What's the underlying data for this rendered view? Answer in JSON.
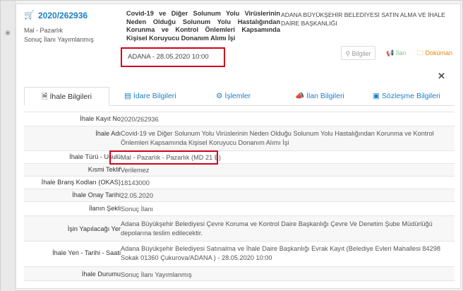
{
  "ihale": {
    "no": "2020/262936",
    "type": "Mal - Pazarlık",
    "status": "Sonuç İlanı Yayımlanmış",
    "title": "Covid-19 ve Diğer Solunum Yolu Virüslerinin Neden Olduğu Solunum Yolu Hastalığından Korunma ve Kontrol Önlemleri Kapsamında Kişisel Koruyucu Donanım Alımı İşi",
    "place_date": "ADANA - 28.05.2020 10:00",
    "org": "ADANA BÜYÜKŞEHİR BELEDİYESİ SATIN ALMA VE İHALE DAİRE BAŞKANLIĞI"
  },
  "buttons": {
    "bilgiler": "Bilgiler",
    "ilan": "İlan",
    "dokuman": "Doküman"
  },
  "tabs": [
    {
      "label": "İhale Bilgileri",
      "icon": "file-icon"
    },
    {
      "label": "İdare Bilgileri",
      "icon": "document-icon"
    },
    {
      "label": "İşlemler",
      "icon": "gears-icon"
    },
    {
      "label": "İlan Bilgileri",
      "icon": "bullhorn-icon"
    },
    {
      "label": "Sözleşme Bilgileri",
      "icon": "contract-icon"
    }
  ],
  "rows": [
    {
      "label": "İhale Kayıt No",
      "value": "2020/262936"
    },
    {
      "label": "İhale Adı",
      "value": "Covid-19 ve Diğer Solunum Yolu Virüslerinin Neden Olduğu Solunum Yolu Hastalığından Korunma ve Kontrol Önlemleri Kapsamında Kişisel Koruyucu Donanım Alımı İşi"
    },
    {
      "label": "İhale Türü - Usulü",
      "value": "Mal - Pazarlık - Pazarlık (MD 21 B)"
    },
    {
      "label": "Kısmi Teklif",
      "value": "Verilemez"
    },
    {
      "label": "İhale Branş Kodları (OKAS)",
      "value": "18143000"
    },
    {
      "label": "İhale Onay Tarihi",
      "value": "22.05.2020"
    },
    {
      "label": "İlanın Şekli",
      "value": "Sonuç İlanı"
    },
    {
      "label": "İşin Yapılacağı Yer",
      "value": "Adana Büyükşehir Belediyesi Çevre Koruma ve Kontrol Daire Başkanlığı Çevre Ve Denetim Şube Müdürlüğü depolarına teslim edilecektir."
    },
    {
      "label": "İhale Yeri - Tarihi - Saati",
      "value": "Adana Büyükşehir Belediyesi Satınalma ve İhale Daire Başkanlığı Evrak Kayıt (Belediye Evleri Mahallesi 84298 Sokak 01360 Çukurova/ADANA ) - 28.05.2020 10:00"
    },
    {
      "label": "İhale Durumu",
      "value": "Sonuç İlanı Yayımlanmış"
    }
  ]
}
